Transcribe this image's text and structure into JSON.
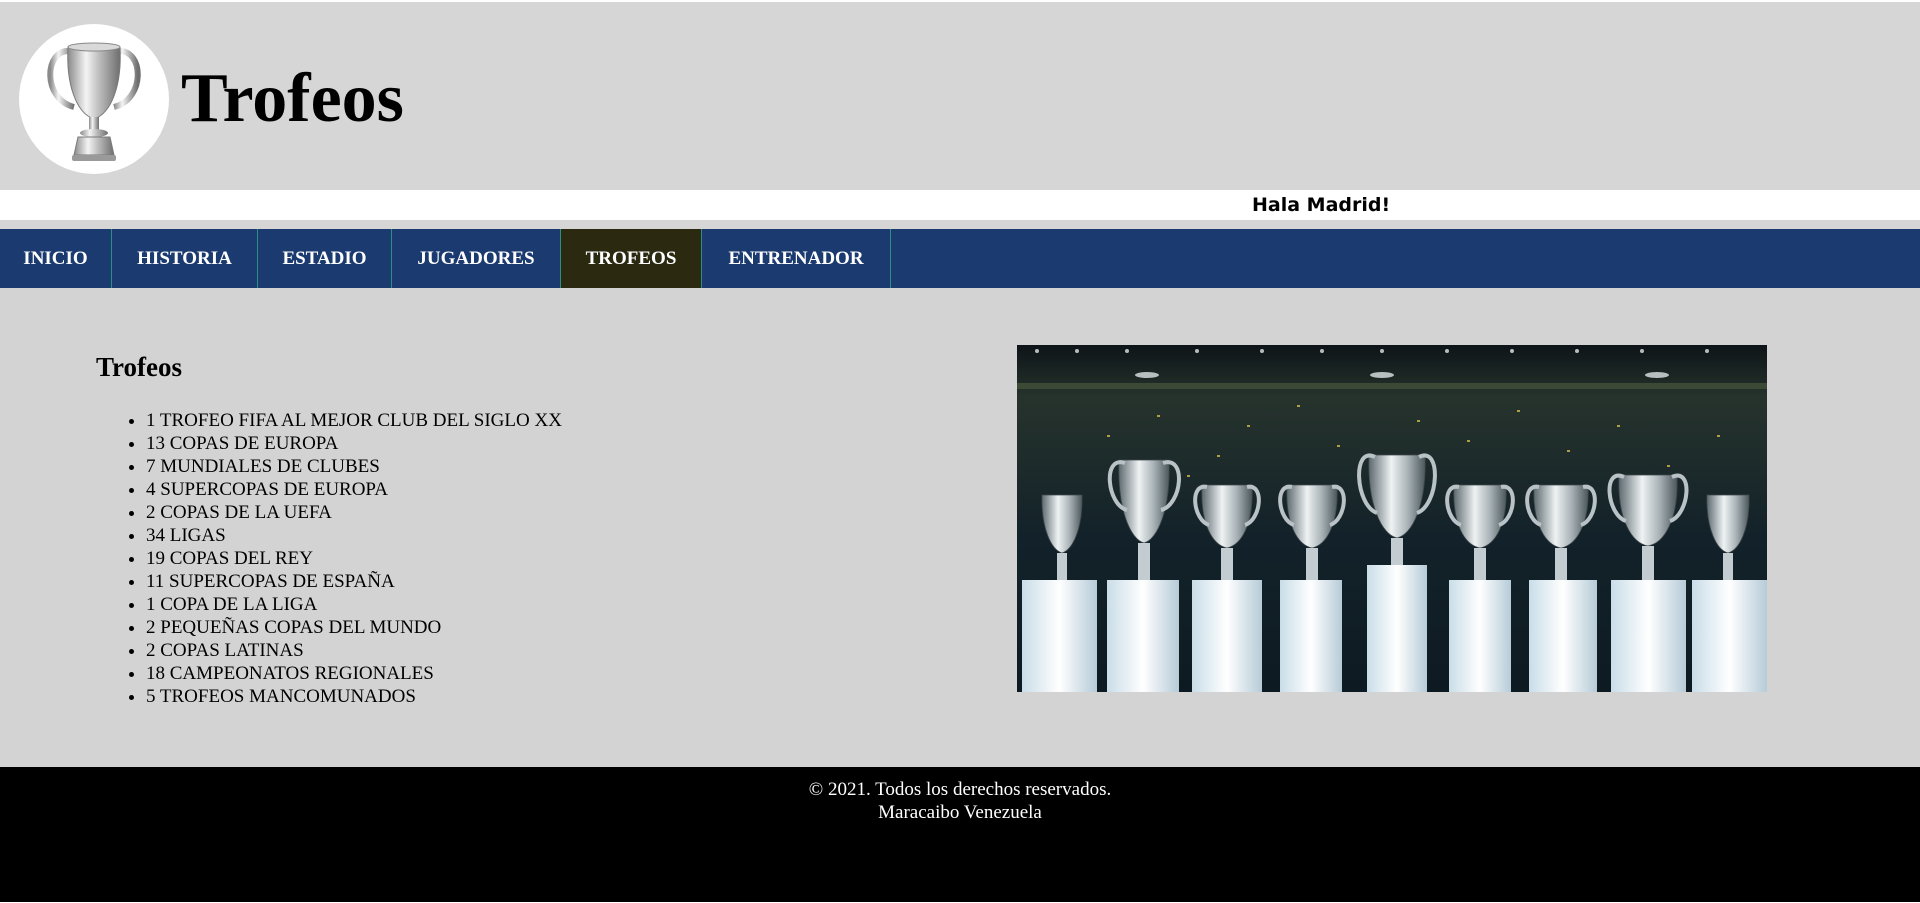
{
  "header": {
    "title": "Trofeos",
    "logo_icon": "trophy-icon"
  },
  "marquee": {
    "text": "Hala Madrid!"
  },
  "nav": {
    "items": [
      {
        "label": "INICIO"
      },
      {
        "label": "HISTORIA"
      },
      {
        "label": "ESTADIO"
      },
      {
        "label": "JUGADORES"
      },
      {
        "label": "TROFEOS",
        "active": true
      },
      {
        "label": "ENTRENADOR"
      }
    ],
    "colors": {
      "bar": "#1b3a70",
      "active": "#2b2a11",
      "divider": "#2c8f86"
    }
  },
  "main": {
    "heading": "Trofeos",
    "trophies": [
      "1 TROFEO FIFA AL MEJOR CLUB DEL SIGLO XX",
      "13 COPAS DE EUROPA",
      "7 MUNDIALES DE CLUBES",
      "4 SUPERCOPAS DE EUROPA",
      "2 COPAS DE LA UEFA",
      "34 LIGAS",
      "19 COPAS DEL REY",
      "11 SUPERCOPAS DE ESPAÑA",
      "1 COPA DE LA LIGA",
      "2 PEQUEÑAS COPAS DEL MUNDO",
      "2 COPAS LATINAS",
      "18 CAMPEONATOS REGIONALES",
      "5 TROFEOS MANCOMUNADOS"
    ],
    "photo_icon": "trophy-display-photo"
  },
  "footer": {
    "copyright": "© 2021. Todos los derechos reservados.",
    "location": "Maracaibo Venezuela"
  }
}
